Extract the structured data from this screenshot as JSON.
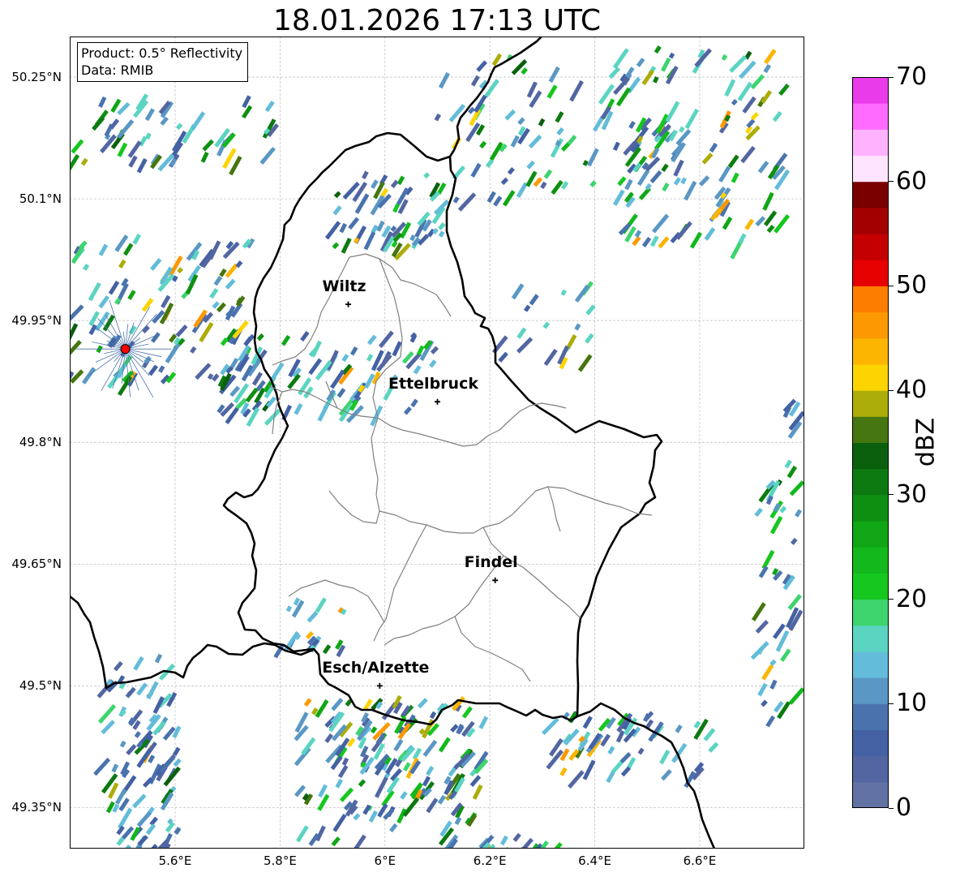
{
  "title": "18.01.2026 17:13 UTC",
  "info": {
    "product": "Product: 0.5° Reflectivity",
    "data": "Data: RMIB"
  },
  "map": {
    "lon_range": [
      5.4,
      6.8
    ],
    "lat_range": [
      49.3,
      50.3
    ],
    "y_ticks": [
      {
        "lat": 50.25,
        "label": "50.25°N"
      },
      {
        "lat": 50.1,
        "label": "50.1°N"
      },
      {
        "lat": 49.95,
        "label": "49.95°N"
      },
      {
        "lat": 49.8,
        "label": "49.8°N"
      },
      {
        "lat": 49.65,
        "label": "49.65°N"
      },
      {
        "lat": 49.5,
        "label": "49.5°N"
      },
      {
        "lat": 49.35,
        "label": "49.35°N"
      }
    ],
    "x_ticks": [
      {
        "lon": 5.6,
        "label": "5.6°E"
      },
      {
        "lon": 5.8,
        "label": "5.8°E"
      },
      {
        "lon": 6.0,
        "label": "6°E"
      },
      {
        "lon": 6.2,
        "label": "6.2°E"
      },
      {
        "lon": 6.4,
        "label": "6.4°E"
      },
      {
        "lon": 6.6,
        "label": "6.6°E"
      }
    ],
    "cities": [
      {
        "name": "Wiltz",
        "lon": 5.93,
        "lat": 49.97
      },
      {
        "name": "Ettelbruck",
        "lon": 6.1,
        "lat": 49.85
      },
      {
        "name": "Findel",
        "lon": 6.21,
        "lat": 49.63
      },
      {
        "name": "Esch/Alzette",
        "lon": 5.99,
        "lat": 49.5
      }
    ],
    "radar_site": {
      "lon": 5.505,
      "lat": 49.915
    },
    "border_color": "#000000",
    "canton_color": "#808080",
    "grid_color": "#bbbbbb"
  },
  "colorbar": {
    "label": "dBZ",
    "min": 0,
    "max": 70,
    "step": 2.5,
    "ticks": [
      {
        "value": 0,
        "label": "0"
      },
      {
        "value": 10,
        "label": "10"
      },
      {
        "value": 20,
        "label": "20"
      },
      {
        "value": 30,
        "label": "30"
      },
      {
        "value": 40,
        "label": "40"
      },
      {
        "value": 50,
        "label": "50"
      },
      {
        "value": 60,
        "label": "60"
      },
      {
        "value": 70,
        "label": "70"
      }
    ],
    "colors": [
      "#6272a4",
      "#5366a2",
      "#4461a3",
      "#4a73ad",
      "#5a97c4",
      "#63bcd9",
      "#5bd4c2",
      "#3ed46e",
      "#16c71f",
      "#12b81c",
      "#10a615",
      "#0e8f12",
      "#0c7a10",
      "#0a600d",
      "#45760f",
      "#acad0a",
      "#fcd400",
      "#fcb500",
      "#fc9900",
      "#fc7d00",
      "#e60000",
      "#c40000",
      "#a30000",
      "#7a0000",
      "#ffe4ff",
      "#ffb3ff",
      "#ff6bff",
      "#ea3bea"
    ]
  }
}
